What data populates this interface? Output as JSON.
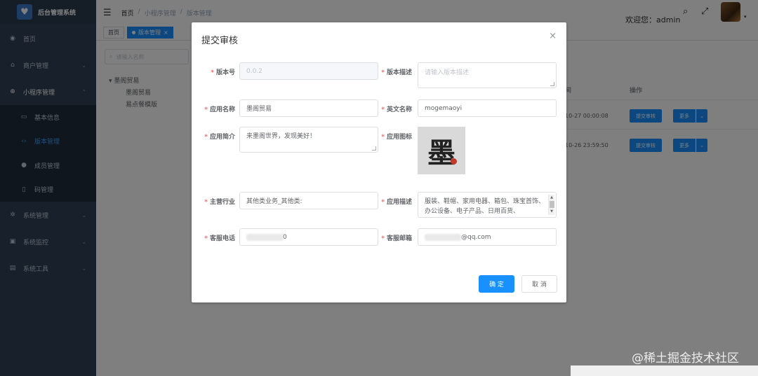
{
  "app": {
    "title": "后台管理系统",
    "logo_icon": "heart-icon"
  },
  "sidebar": {
    "items": [
      {
        "label": "首页",
        "icon": "dashboard-icon"
      },
      {
        "label": "商户管理",
        "icon": "shop-icon"
      },
      {
        "label": "小程序管理",
        "icon": "miniapp-icon"
      },
      {
        "label": "系统管理",
        "icon": "gear-icon"
      },
      {
        "label": "系统监控",
        "icon": "monitor-icon"
      },
      {
        "label": "系统工具",
        "icon": "toolbox-icon"
      }
    ],
    "sub_items": [
      {
        "label": "基本信息",
        "icon": "card-icon"
      },
      {
        "label": "版本管理",
        "icon": "code-icon"
      },
      {
        "label": "成员管理",
        "icon": "user-icon"
      },
      {
        "label": "码管理",
        "icon": "phone-icon"
      }
    ]
  },
  "navbar": {
    "breadcrumb": [
      "首页",
      "/",
      "小程序管理",
      "/",
      "版本管理"
    ],
    "welcome": "欢迎您：admin"
  },
  "tags": {
    "home": "首页",
    "active": "版本管理",
    "close": "×"
  },
  "main": {
    "tree_search_placeholder": "请输入名称",
    "tree": {
      "root": "墨阁贸易",
      "children": [
        "墨阁贸易",
        "易点餐模版"
      ]
    },
    "table": {
      "header_time": "间",
      "header_ops": "操作",
      "rows": [
        {
          "time": "10-27 00:00:08",
          "submit": "提交审核",
          "more": "更多"
        },
        {
          "time": "10-26 23:59:50",
          "submit": "提交审核",
          "more": "更多"
        }
      ]
    }
  },
  "dialog": {
    "title": "提交审核",
    "close": "×",
    "fields": {
      "version_no": {
        "label": "版本号",
        "value": "0.0.2"
      },
      "version_desc": {
        "label": "版本描述",
        "placeholder": "请输入版本描述"
      },
      "app_name": {
        "label": "应用名称",
        "value": "墨阁贸易"
      },
      "en_name": {
        "label": "英文名称",
        "value": "mogemaoyi"
      },
      "app_intro": {
        "label": "应用简介",
        "value": "来墨阁世界，发现美好！"
      },
      "app_icon": {
        "label": "应用图标",
        "glyph": "墨"
      },
      "industry": {
        "label": "主营行业",
        "value": "其他类业务_其他类:"
      },
      "app_desc": {
        "label": "应用描述",
        "value": "服装、鞋帽、家用电器、箱包、珠宝首饰、办公设备、电子产品、日用百货、"
      },
      "service_phone": {
        "label": "客服电话",
        "value_suffix": "0"
      },
      "service_email": {
        "label": "客服邮箱",
        "value_suffix": "@qq.com"
      }
    },
    "confirm": "确 定",
    "cancel": "取 消"
  },
  "watermark": "@稀土掘金技术社区"
}
